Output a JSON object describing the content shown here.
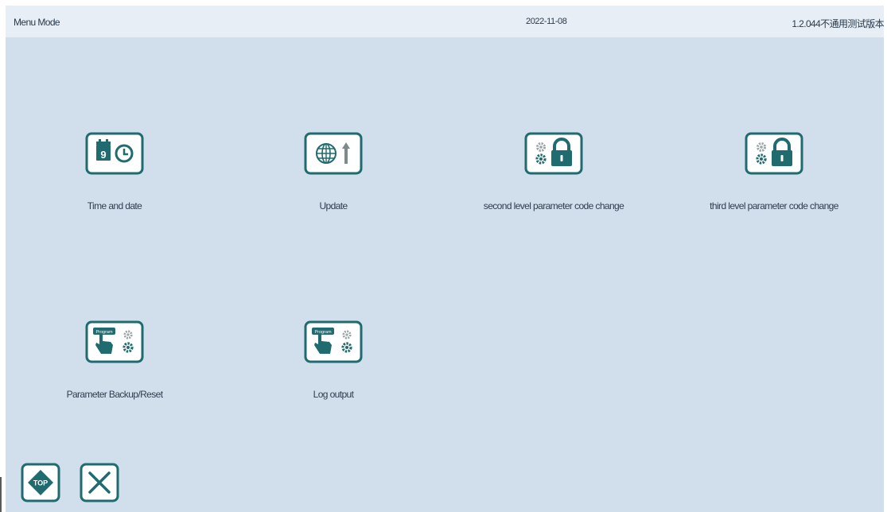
{
  "header": {
    "mode": "Menu Mode",
    "date": "2022-11-08",
    "version": "1.2.044不通用测试版本"
  },
  "menu": {
    "items": [
      {
        "label": "Time and date",
        "icon": "calendar-clock-icon"
      },
      {
        "label": "Update",
        "icon": "globe-upload-icon"
      },
      {
        "label": "second level parameter code change",
        "icon": "gear-lock-icon"
      },
      {
        "label": "third level parameter code change",
        "icon": "gear-lock-icon"
      },
      {
        "label": "Parameter Backup/Reset",
        "icon": "program-hand-gear-icon"
      },
      {
        "label": "Log output",
        "icon": "program-hand-gear-icon"
      }
    ]
  },
  "footer": {
    "top_icon": "top-icon",
    "top_text": "TOP",
    "close_icon": "close-icon"
  },
  "colors": {
    "background": "#d1deec",
    "header": "#e7eef6",
    "icon_teal": "#1f6b6f",
    "text": "#2e3e4e"
  }
}
